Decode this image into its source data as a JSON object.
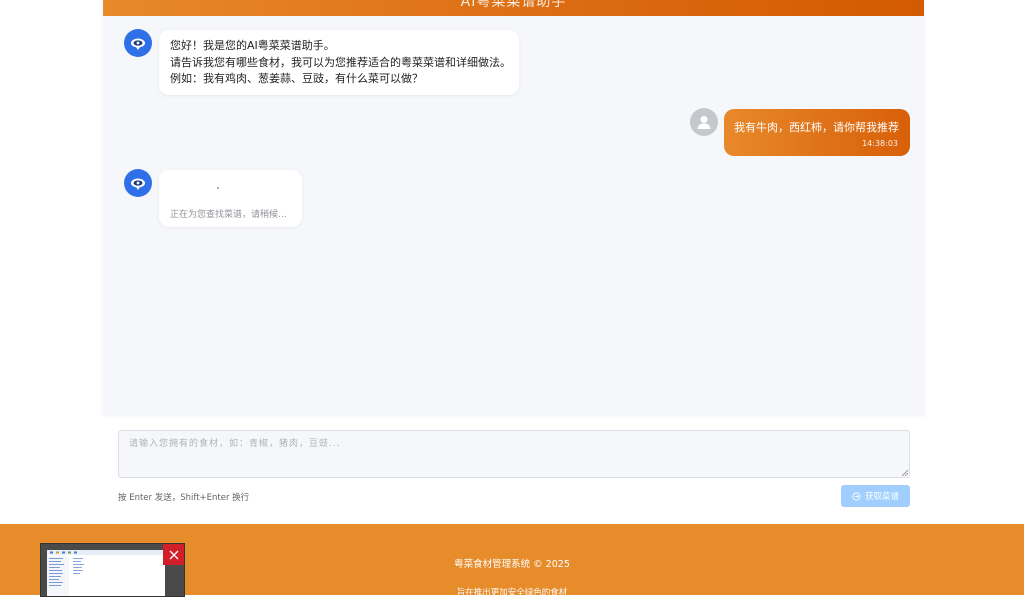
{
  "header": {
    "title": "AI粤菜菜谱助手"
  },
  "messages": {
    "bot_welcome": {
      "line1": "您好！我是您的AI粤菜菜谱助手。",
      "line2": "请告诉我您有哪些食材，我可以为您推荐适合的粤菜菜谱和详细做法。",
      "line3": "例如：我有鸡肉、葱姜蒜、豆豉，有什么菜可以做？"
    },
    "user_message": {
      "text": "我有牛肉，西红柿，请你帮我推荐",
      "time": "14:38:03"
    },
    "bot_loading": {
      "text": "正在为您查找菜谱，请稍候..."
    }
  },
  "input": {
    "placeholder": "请输入您拥有的食材，如：青椒，猪肉，豆豉...",
    "value": "",
    "hint": "按 Enter 发送，Shift+Enter 换行",
    "send_label": "获取菜谱"
  },
  "footer": {
    "copyright": "粤菜食材管理系统 © 2025",
    "slogan": "旨在推出更加安全绿色的食材"
  },
  "icons": {
    "bot_avatar": "robot-avatar-icon",
    "user_avatar": "user-avatar-icon",
    "send": "send-icon",
    "close": "close-icon"
  },
  "colors": {
    "accent_orange": "#e68c2b",
    "bot_blue": "#2f6fe8",
    "send_disabled": "#a0cfff",
    "close_red": "#d11f2a"
  }
}
